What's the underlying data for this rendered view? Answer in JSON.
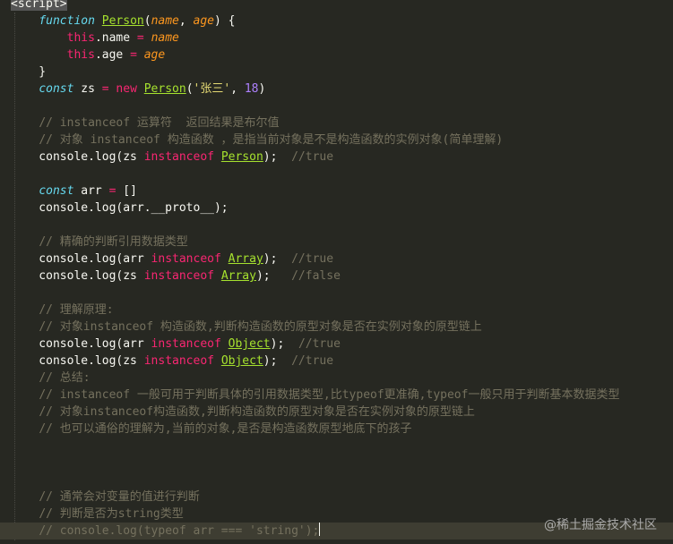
{
  "colors": {
    "background": "#272822",
    "keyword": "#66D9EF",
    "operator": "#F92672",
    "function_name": "#A6E22E",
    "parameter": "#FD971F",
    "string": "#E6DB74",
    "number": "#AE81FF",
    "comment": "#75715E",
    "plain": "#F8F8F2"
  },
  "lines": [
    [
      [
        "tag",
        "<script>"
      ]
    ],
    [
      [
        "plain",
        "    "
      ],
      [
        "kw",
        "function"
      ],
      [
        "plain",
        " "
      ],
      [
        "fn",
        "Person"
      ],
      [
        "plain",
        "("
      ],
      [
        "param",
        "name"
      ],
      [
        "plain",
        ", "
      ],
      [
        "param",
        "age"
      ],
      [
        "plain",
        ") {"
      ]
    ],
    [
      [
        "plain",
        "        "
      ],
      [
        "this",
        "this"
      ],
      [
        "plain",
        ".name "
      ],
      [
        "op",
        "="
      ],
      [
        "plain",
        " "
      ],
      [
        "param",
        "name"
      ]
    ],
    [
      [
        "plain",
        "        "
      ],
      [
        "this",
        "this"
      ],
      [
        "plain",
        ".age "
      ],
      [
        "op",
        "="
      ],
      [
        "plain",
        " "
      ],
      [
        "param",
        "age"
      ]
    ],
    [
      [
        "plain",
        "    }"
      ]
    ],
    [
      [
        "plain",
        "    "
      ],
      [
        "kw",
        "const"
      ],
      [
        "plain",
        " zs "
      ],
      [
        "op",
        "="
      ],
      [
        "plain",
        " "
      ],
      [
        "new",
        "new"
      ],
      [
        "plain",
        " "
      ],
      [
        "fn",
        "Person"
      ],
      [
        "plain",
        "("
      ],
      [
        "str",
        "'张三'"
      ],
      [
        "plain",
        ", "
      ],
      [
        "num",
        "18"
      ],
      [
        "plain",
        ")"
      ]
    ],
    [],
    [
      [
        "plain",
        "    "
      ],
      [
        "cmt",
        "// instanceof 运算符  返回结果是布尔值"
      ]
    ],
    [
      [
        "plain",
        "    "
      ],
      [
        "cmt",
        "// 对象 instanceof 构造函数 ，是指当前对象是不是构造函数的实例对象(简单理解)"
      ]
    ],
    [
      [
        "plain",
        "    console.log(zs "
      ],
      [
        "op",
        "instanceof"
      ],
      [
        "plain",
        " "
      ],
      [
        "fn",
        "Person"
      ],
      [
        "plain",
        ");  "
      ],
      [
        "cmt",
        "//true"
      ]
    ],
    [],
    [
      [
        "plain",
        "    "
      ],
      [
        "kw",
        "const"
      ],
      [
        "plain",
        " arr "
      ],
      [
        "op",
        "="
      ],
      [
        "plain",
        " []"
      ]
    ],
    [
      [
        "plain",
        "    console.log(arr.__proto__);"
      ]
    ],
    [],
    [
      [
        "plain",
        "    "
      ],
      [
        "cmt",
        "// 精确的判断引用数据类型"
      ]
    ],
    [
      [
        "plain",
        "    console.log(arr "
      ],
      [
        "op",
        "instanceof"
      ],
      [
        "plain",
        " "
      ],
      [
        "fn",
        "Array"
      ],
      [
        "plain",
        ");  "
      ],
      [
        "cmt",
        "//true"
      ]
    ],
    [
      [
        "plain",
        "    console.log(zs "
      ],
      [
        "op",
        "instanceof"
      ],
      [
        "plain",
        " "
      ],
      [
        "fn",
        "Array"
      ],
      [
        "plain",
        ");   "
      ],
      [
        "cmt",
        "//false"
      ]
    ],
    [],
    [
      [
        "plain",
        "    "
      ],
      [
        "cmt",
        "// 理解原理:"
      ]
    ],
    [
      [
        "plain",
        "    "
      ],
      [
        "cmt",
        "// 对象instanceof 构造函数,判断构造函数的原型对象是否在实例对象的原型链上"
      ]
    ],
    [
      [
        "plain",
        "    console.log(arr "
      ],
      [
        "op",
        "instanceof"
      ],
      [
        "plain",
        " "
      ],
      [
        "fn",
        "Object"
      ],
      [
        "plain",
        ");  "
      ],
      [
        "cmt",
        "//true"
      ]
    ],
    [
      [
        "plain",
        "    console.log(zs "
      ],
      [
        "op",
        "instanceof"
      ],
      [
        "plain",
        " "
      ],
      [
        "fn",
        "Object"
      ],
      [
        "plain",
        ");  "
      ],
      [
        "cmt",
        "//true"
      ]
    ],
    [
      [
        "plain",
        "    "
      ],
      [
        "cmt",
        "// 总结:"
      ]
    ],
    [
      [
        "plain",
        "    "
      ],
      [
        "cmt",
        "// instanceof 一般可用于判断具体的引用数据类型,比typeof更准确,typeof一般只用于判断基本数据类型"
      ]
    ],
    [
      [
        "plain",
        "    "
      ],
      [
        "cmt",
        "// 对象instanceof构造函数,判断构造函数的原型对象是否在实例对象的原型链上"
      ]
    ],
    [
      [
        "plain",
        "    "
      ],
      [
        "cmt",
        "// 也可以通俗的理解为,当前的对象,是否是构造函数原型地底下的孩子"
      ]
    ],
    [],
    [],
    [],
    [
      [
        "plain",
        "    "
      ],
      [
        "cmt",
        "// 通常会对变量的值进行判断"
      ]
    ],
    [
      [
        "plain",
        "    "
      ],
      [
        "cmt",
        "// 判断是否为string类型"
      ]
    ],
    [
      [
        "plain",
        "    "
      ],
      [
        "cmt",
        "// console.log(typeof arr === 'string');"
      ]
    ]
  ],
  "cursor_line": 31,
  "watermark": "@稀土掘金技术社区"
}
